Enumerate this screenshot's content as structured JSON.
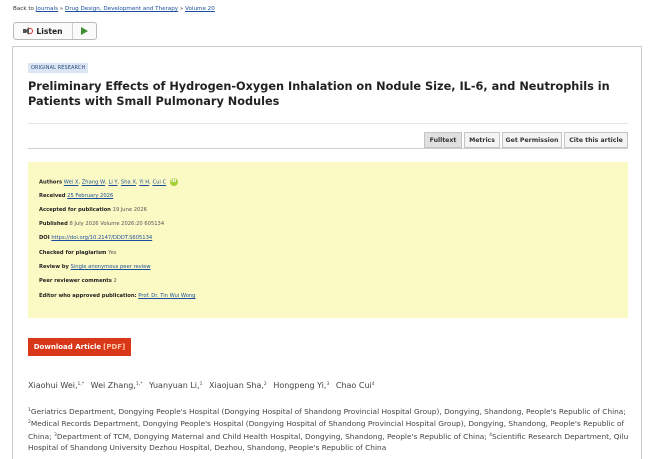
{
  "breadcrumb": {
    "prefix": "Back to ",
    "journals": "Journals",
    "sep1": " » ",
    "journal": "Drug Design, Development and Therapy",
    "sep2": " » ",
    "volume": "Volume 20"
  },
  "listen": {
    "label": "Listen",
    "speaker_icon": "speaker-icon",
    "play_icon": "play-icon"
  },
  "article": {
    "category": "ORIGINAL RESEARCH",
    "title": "Preliminary Effects of Hydrogen-Oxygen Inhalation on Nodule Size, IL-6, and Neutrophils in Patients with Small Pulmonary Nodules"
  },
  "tabs": [
    {
      "label": "Fulltext",
      "active": true
    },
    {
      "label": "Metrics",
      "active": false
    },
    {
      "label": "Get Permission",
      "active": false
    },
    {
      "label": "Cite this article",
      "active": false
    }
  ],
  "meta": {
    "authors_label": "Authors",
    "authors": [
      "Wei X",
      "Zhang W",
      "Li Y",
      "Sha X",
      "Yi H",
      "Cui C"
    ],
    "orcid_icon": "iD",
    "received_label": "Received",
    "received": "25 February 2026",
    "accepted_label": "Accepted for publication",
    "accepted": "19 June 2026",
    "published_label": "Published",
    "published": "8 July 2026 Volume 2026:20 605134",
    "doi_label": "DOI",
    "doi": "https://doi.org/10.2147/DDDT.S605134",
    "plagiarism_label": "Checked for plagiarism",
    "plagiarism": "Yes",
    "review_label": "Review by",
    "review": "Single anonymous peer review",
    "peer_comments_label": "Peer reviewer comments",
    "peer_comments": "2",
    "editor_label": "Editor who approved publication:",
    "editor": "Prof. Dr. Tin Wui Wong"
  },
  "download": {
    "label": "Download Article",
    "format": "[PDF]"
  },
  "authors_line": [
    {
      "name": "Xiaohui Wei,",
      "sup": "1,*"
    },
    {
      "name": "Wei Zhang,",
      "sup": "1,*"
    },
    {
      "name": "Yuanyuan Li,",
      "sup": "1"
    },
    {
      "name": "Xiaojuan Sha,",
      "sup": "2"
    },
    {
      "name": "Hongpeng Yi,",
      "sup": "3"
    },
    {
      "name": "Chao Cui",
      "sup": "4"
    }
  ],
  "affiliations": [
    {
      "sup": "1",
      "text": "Geriatrics Department, Dongying People's Hospital (Dongying Hospital of Shandong Provincial Hospital Group), Dongying, Shandong, People's Republic of China; "
    },
    {
      "sup": "2",
      "text": "Medical Records Department, Dongying People's Hospital (Dongying Hospital of Shandong Provincial Hospital Group), Dongying, Shandong, People's Republic of China; "
    },
    {
      "sup": "3",
      "text": "Department of TCM, Dongying Maternal and Child Health Hospital, Dongying, Shandong, People's Republic of China; "
    },
    {
      "sup": "4",
      "text": "Scientific Research Department, Qilu Hospital of Shandong University Dezhou Hospital, Dezhou, Shandong, People's Republic of China"
    }
  ]
}
